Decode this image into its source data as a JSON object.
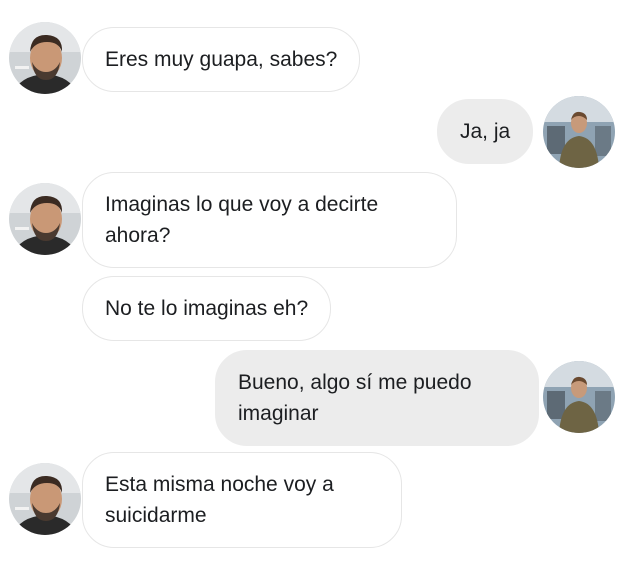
{
  "conversation": {
    "messages": [
      {
        "sender": "contact",
        "lines": [
          "Eres muy guapa, sabes?"
        ]
      },
      {
        "sender": "user",
        "lines": [
          "Ja, ja"
        ]
      },
      {
        "sender": "contact",
        "lines": [
          "Imaginas lo que voy a decirte",
          "ahora?"
        ]
      },
      {
        "sender": "contact",
        "lines": [
          "No te lo imaginas eh?"
        ]
      },
      {
        "sender": "user",
        "lines": [
          "Bueno, algo sí me puedo",
          "imaginar"
        ]
      },
      {
        "sender": "contact",
        "lines": [
          "Esta misma noche voy a",
          "suicidarme"
        ]
      }
    ]
  },
  "colors": {
    "incoming_bubble": "#ffffff",
    "incoming_border": "#e6e6e6",
    "outgoing_bubble": "#ececec",
    "text": "#1c1e21"
  },
  "icons": {
    "contact_avatar": "contact-avatar-photo",
    "user_avatar": "user-avatar-photo"
  }
}
